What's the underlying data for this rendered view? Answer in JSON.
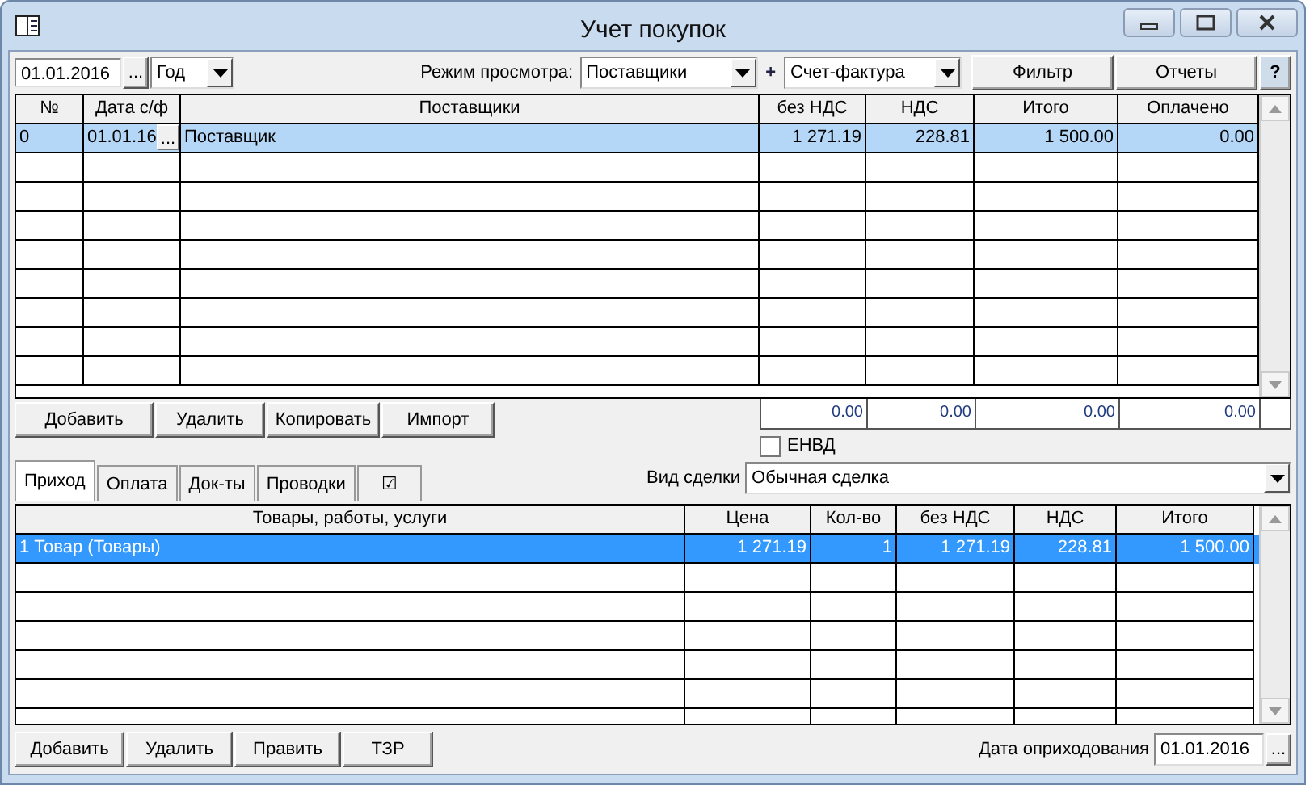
{
  "window": {
    "title": "Учет покупок"
  },
  "toolbar": {
    "date": "01.01.2016",
    "date_button": "...",
    "period": "Год",
    "view_label": "Режим просмотра:",
    "view_mode": "Поставщики",
    "plus": "+",
    "document_type": "Счет-фактура",
    "buttons": [
      "Фильтр",
      "Отчеты"
    ],
    "help": "?"
  },
  "invoices": {
    "columns": [
      "№",
      "Дата с/ф",
      "Поставщики",
      "без НДС",
      "НДС",
      "Итого",
      "Оплачено"
    ],
    "rows": [
      {
        "cells": [
          "0",
          "01.01.16",
          "Поставщик",
          "1 271.19",
          "228.81",
          "1 500.00",
          "0.00"
        ],
        "date_button": "...",
        "selected": true
      }
    ],
    "totals": [
      "0.00",
      "0.00",
      "0.00",
      "0.00"
    ]
  },
  "invoice_buttons": [
    "Добавить",
    "Удалить",
    "Копировать",
    "Импорт"
  ],
  "envd": {
    "label": "ЕНВД",
    "checked": false
  },
  "tabs": [
    {
      "label": "Приход",
      "selected": true
    },
    {
      "label": "Оплата",
      "selected": false
    },
    {
      "label": "Док-ты",
      "selected": false
    },
    {
      "label": "Проводки",
      "selected": false
    },
    {
      "label": "☑",
      "selected": false
    }
  ],
  "deal_type": {
    "label": "Вид сделки",
    "value": "Обычная сделка"
  },
  "items": {
    "columns": [
      "Товары, работы, услуги",
      "Цена",
      "Кол-во",
      "без НДС",
      "НДС",
      "Итого"
    ],
    "rows": [
      {
        "cells": [
          "1 Товар (Товары)",
          "1 271.19",
          "1",
          "1 271.19",
          "228.81",
          "1 500.00"
        ],
        "selected": true
      }
    ]
  },
  "item_buttons": [
    "Добавить",
    "Удалить",
    "Править",
    "ТЗР"
  ],
  "receipt_date": {
    "label": "Дата оприходования",
    "value": "01.01.2016",
    "button": "..."
  }
}
